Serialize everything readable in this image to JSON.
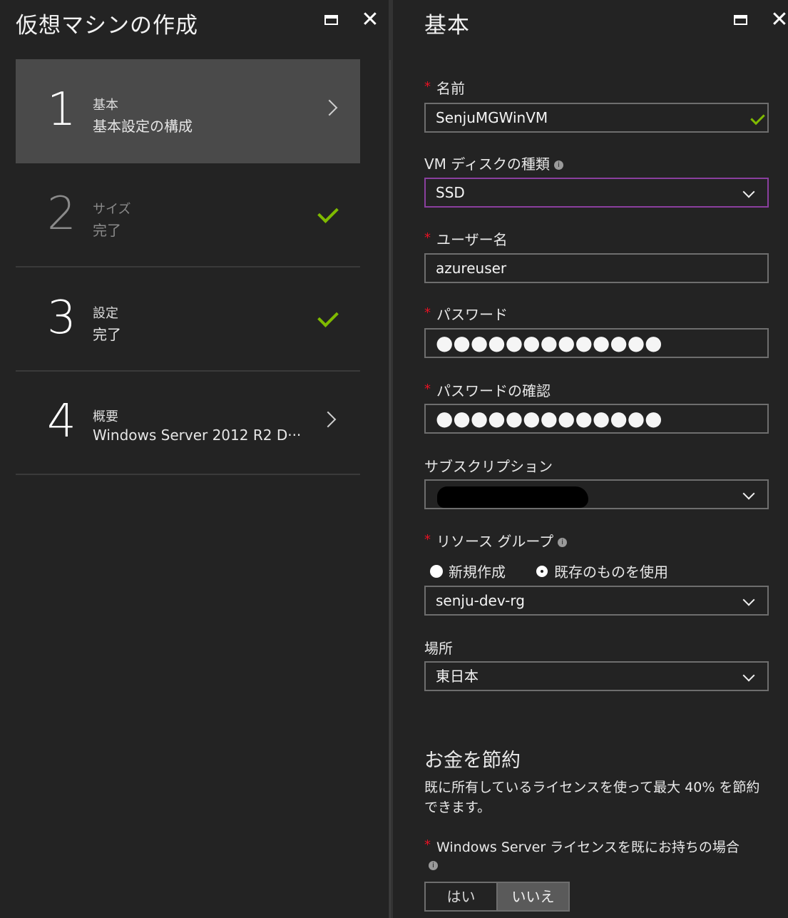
{
  "left_blade": {
    "title": "仮想マシンの作成",
    "steps": [
      {
        "number": "1",
        "title": "基本",
        "subtitle": "基本設定の構成",
        "state": "active"
      },
      {
        "number": "2",
        "title": "サイズ",
        "subtitle": "完了",
        "state": "done"
      },
      {
        "number": "3",
        "title": "設定",
        "subtitle": "完了",
        "state": "done"
      },
      {
        "number": "4",
        "title": "概要",
        "subtitle": "Windows Server 2012 R2 D···",
        "state": "pending"
      }
    ]
  },
  "right_blade": {
    "title": "基本",
    "name": {
      "label": "名前",
      "value": "SenjuMGWinVM"
    },
    "disk_type": {
      "label": "VM ディスクの種類",
      "value": "SSD"
    },
    "username": {
      "label": "ユーザー名",
      "value": "azureuser"
    },
    "password": {
      "label": "パスワード",
      "value": "●●●●●●●●●●●●●"
    },
    "password_confirm": {
      "label": "パスワードの確認",
      "value": "●●●●●●●●●●●●●"
    },
    "subscription": {
      "label": "サブスクリプション",
      "value": ""
    },
    "resource_group": {
      "label": "リソース グループ",
      "option_new": "新規作成",
      "option_existing": "既存のものを使用",
      "selected": "existing",
      "value": "senju-dev-rg"
    },
    "location": {
      "label": "場所",
      "value": "東日本"
    },
    "savings": {
      "heading": "お金を節約",
      "description": "既に所有しているライセンスを使って最大 40% を節約できます。",
      "license_label": "Windows Server ライセンスを既にお持ちの場合",
      "yes": "はい",
      "no": "いいえ",
      "selected": "いいえ"
    }
  },
  "colors": {
    "accent_check": "#7fba00",
    "required": "#e81123",
    "focus_border": "#8a3f9e"
  }
}
